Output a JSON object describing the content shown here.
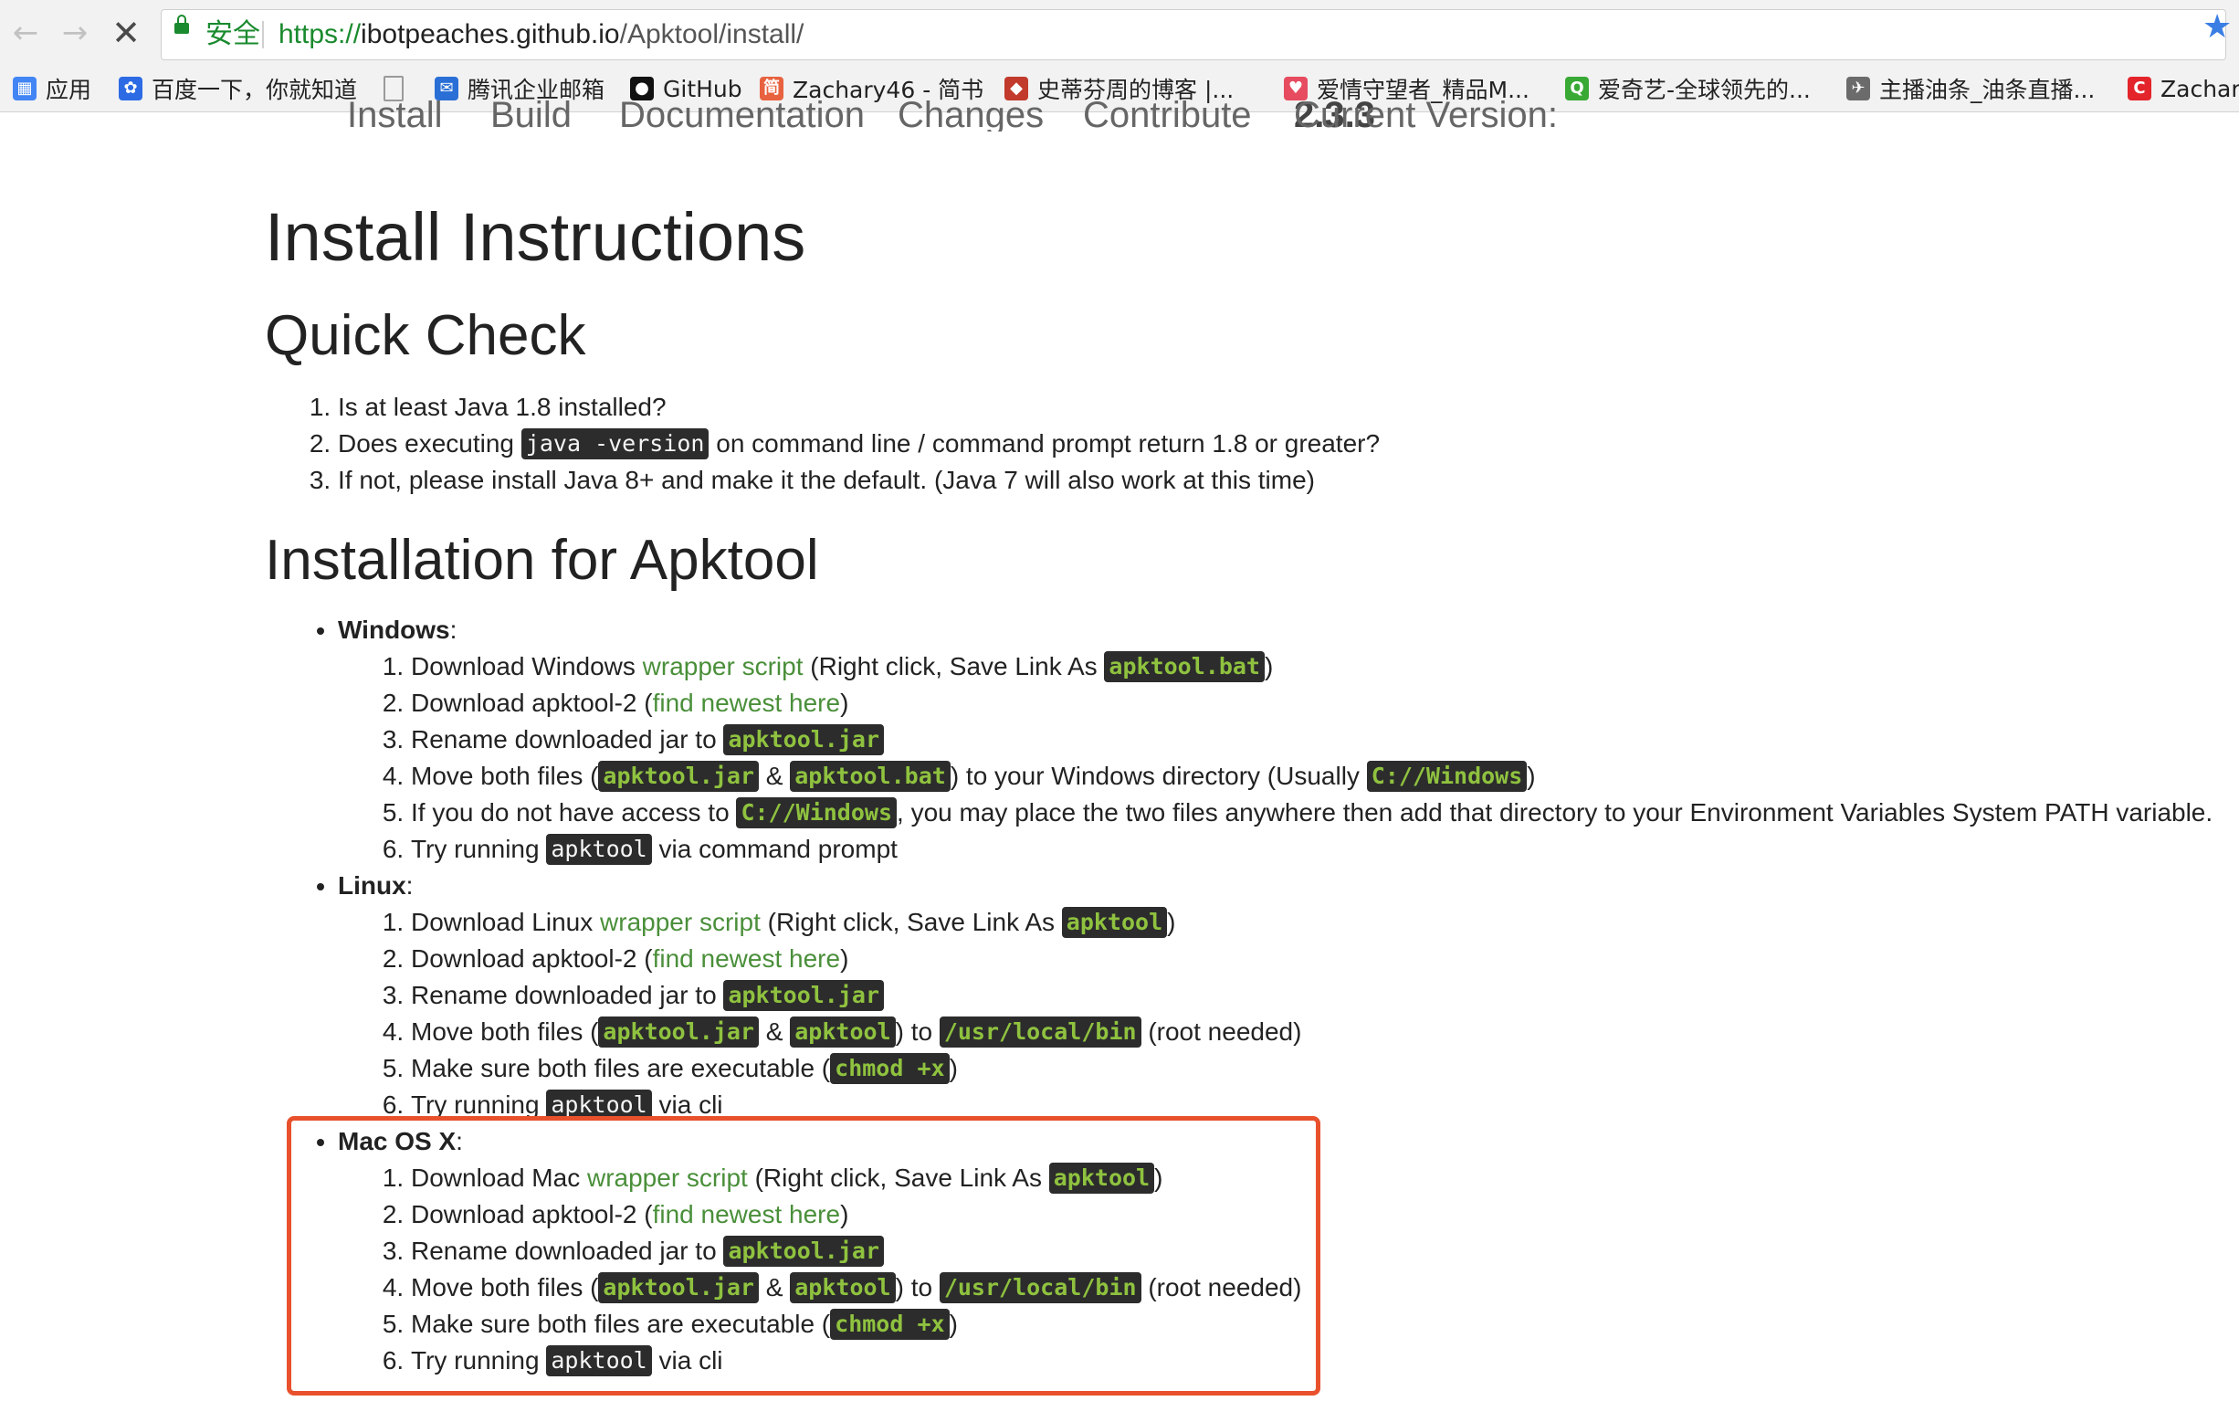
{
  "browser": {
    "secure_label": "安全",
    "url_scheme": "https://",
    "url_host": "ibotpeaches.github.io",
    "url_path": "/Apktool/install/",
    "bookmarks": [
      {
        "label": "应用",
        "icon": "apps-grid-icon",
        "color": "#4285f4"
      },
      {
        "label": "百度一下，你就知道",
        "icon": "baidu-paw-icon",
        "color": "#2d6be4"
      },
      {
        "label": "",
        "icon": "blank-page-icon",
        "color": "#9a9a9a"
      },
      {
        "label": "腾讯企业邮箱",
        "icon": "tencent-mail-icon",
        "color": "#2a6fd6"
      },
      {
        "label": "GitHub",
        "icon": "github-icon",
        "color": "#111111"
      },
      {
        "label": "Zachary46 - 简书",
        "icon": "jianshu-icon",
        "color": "#e8623f"
      },
      {
        "label": "史蒂芬周的博客 |...",
        "icon": "diamond-icon",
        "color": "#c23a2b"
      },
      {
        "label": "爱情守望者_精品M...",
        "icon": "heart-icon",
        "color": "#e64b5f"
      },
      {
        "label": "爱奇艺-全球领先的...",
        "icon": "iqiyi-icon",
        "color": "#39a935"
      },
      {
        "label": "主播油条_油条直播...",
        "icon": "bird-icon",
        "color": "#6b6b6b"
      },
      {
        "label": "Zachar",
        "icon": "c-logo-icon",
        "color": "#e3242b"
      }
    ]
  },
  "site_nav": {
    "items": [
      "Install",
      "Build",
      "Documentation",
      "Changes",
      "Contribute"
    ],
    "version_label": "Current Version:",
    "version": "2.3.3"
  },
  "page": {
    "title": "Install Instructions",
    "quick_check": {
      "title": "Quick Check",
      "item1": "Is at least Java 1.8 installed?",
      "item2_pre": "Does executing ",
      "item2_code": "java -version",
      "item2_post": " on command line / command prompt return 1.8 or greater?",
      "item3": "If not, please install Java 8+ and make it the default. (Java 7 will also work at this time)"
    },
    "installation": {
      "title": "Installation for Apktool",
      "windows": {
        "name": "Windows",
        "s1_pre": "Download Windows ",
        "s1_link": "wrapper script",
        "s1_mid": " (Right click, Save Link As ",
        "s1_code": "apktool.bat",
        "s1_post": ")",
        "s2_pre": "Download apktool-2 (",
        "s2_link": "find newest here",
        "s2_post": ")",
        "s3_pre": "Rename downloaded jar to ",
        "s3_code": "apktool.jar",
        "s4_pre": "Move both files (",
        "s4_code1": "apktool.jar",
        "s4_amp": " & ",
        "s4_code2": "apktool.bat",
        "s4_mid": ") to your Windows directory (Usually ",
        "s4_code3": "C://Windows",
        "s4_post": ")",
        "s5_pre": "If you do not have access to ",
        "s5_code": "C://Windows",
        "s5_post": ", you may place the two files anywhere then add that directory to your Environment Variables System PATH variable.",
        "s6_pre": "Try running ",
        "s6_code": "apktool",
        "s6_post": " via command prompt"
      },
      "linux": {
        "name": "Linux",
        "s1_pre": "Download Linux ",
        "s1_link": "wrapper script",
        "s1_mid": " (Right click, Save Link As ",
        "s1_code": "apktool",
        "s1_post": ")",
        "s2_pre": "Download apktool-2 (",
        "s2_link": "find newest here",
        "s2_post": ")",
        "s3_pre": "Rename downloaded jar to ",
        "s3_code": "apktool.jar",
        "s4_pre": "Move both files (",
        "s4_code1": "apktool.jar",
        "s4_amp": " & ",
        "s4_code2": "apktool",
        "s4_mid": ") to ",
        "s4_code3": "/usr/local/bin",
        "s4_post": " (root needed)",
        "s5_pre": "Make sure both files are executable (",
        "s5_code": "chmod +x",
        "s5_post": ")",
        "s6_pre": "Try running ",
        "s6_code": "apktool",
        "s6_post": " via cli"
      },
      "mac": {
        "name": "Mac OS X",
        "s1_pre": "Download Mac ",
        "s1_link": "wrapper script",
        "s1_mid": " (Right click, Save Link As ",
        "s1_code": "apktool",
        "s1_post": ")",
        "s2_pre": "Download apktool-2 (",
        "s2_link": "find newest here",
        "s2_post": ")",
        "s3_pre": "Rename downloaded jar to ",
        "s3_code": "apktool.jar",
        "s4_pre": "Move both files (",
        "s4_code1": "apktool.jar",
        "s4_amp": " & ",
        "s4_code2": "apktool",
        "s4_mid": ") to ",
        "s4_code3": "/usr/local/bin",
        "s4_post": " (root needed)",
        "s5_pre": "Make sure both files are executable (",
        "s5_code": "chmod +x",
        "s5_post": ")",
        "s6_pre": "Try running ",
        "s6_code": "apktool",
        "s6_post": " via cli"
      }
    }
  },
  "colors": {
    "link_green": "#4a8f3a",
    "code_green": "#8fc23f",
    "highlight": "#e8512c"
  }
}
